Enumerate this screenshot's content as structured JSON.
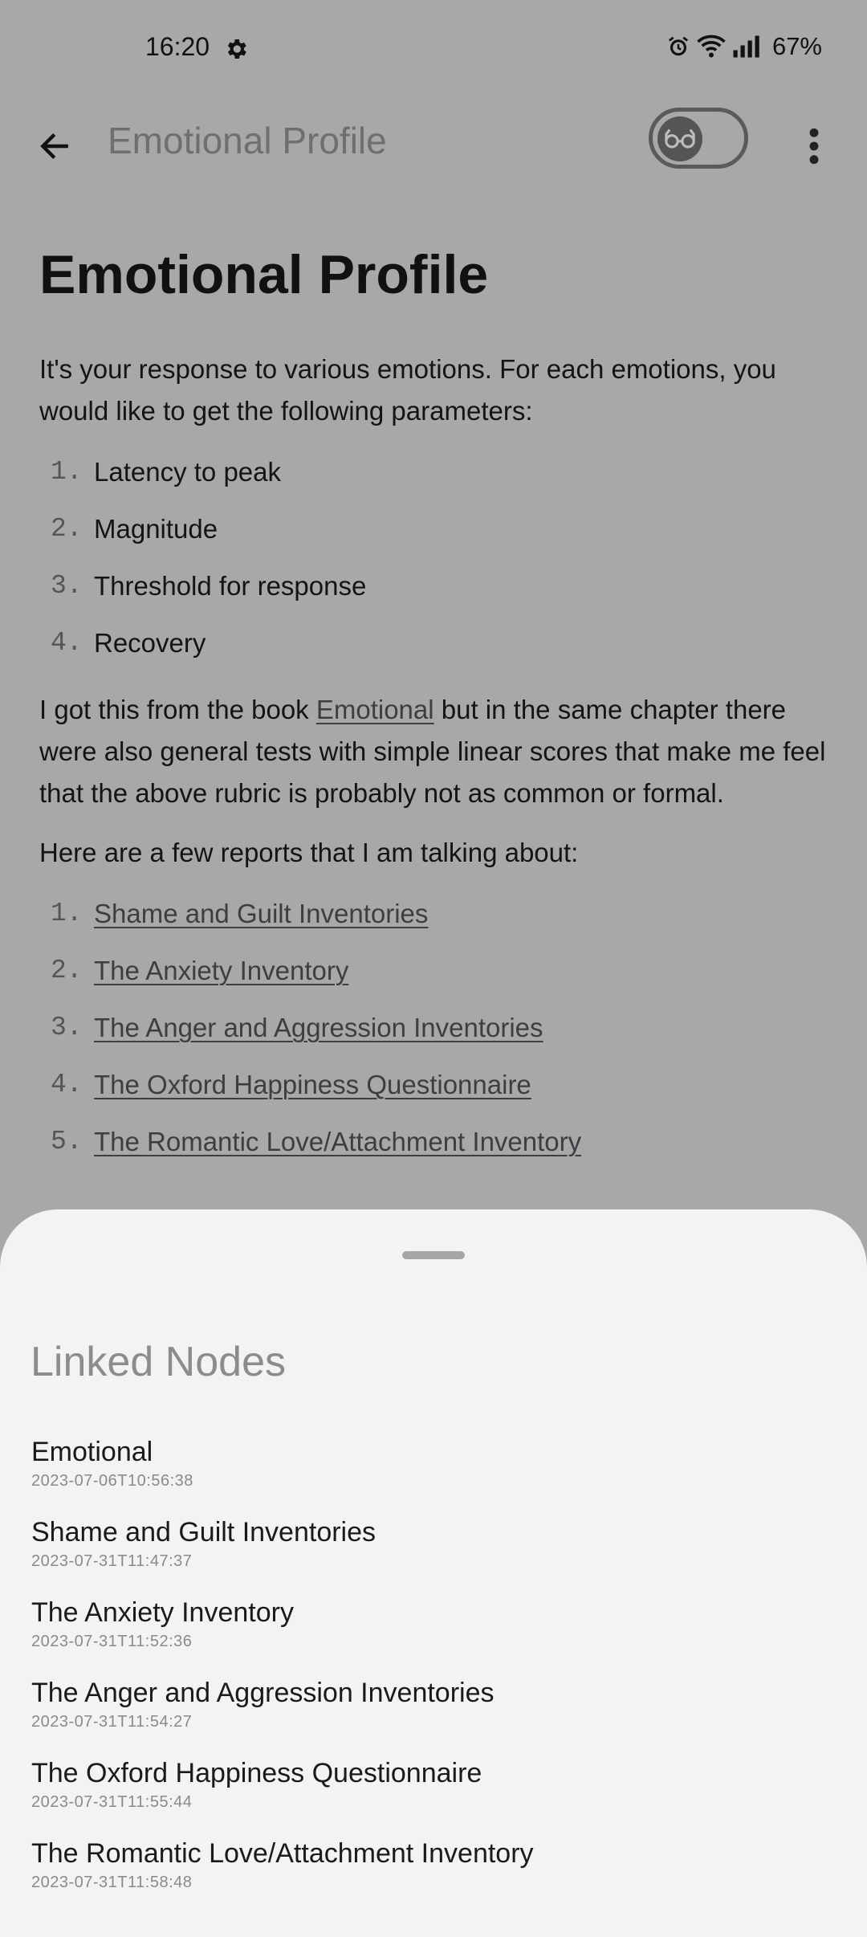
{
  "status": {
    "time": "16:20",
    "battery": "67%"
  },
  "appbar": {
    "title": "Emotional Profile"
  },
  "article": {
    "heading": "Emotional Profile",
    "intro": "It's your response to various emotions. For each emotions, you would like to get the following parameters:",
    "params": [
      {
        "num": "1.",
        "text": "Latency to peak"
      },
      {
        "num": "2.",
        "text": "Magnitude"
      },
      {
        "num": "3.",
        "text": "Threshold for response"
      },
      {
        "num": "4.",
        "text": "Recovery"
      }
    ],
    "para2_before": "I got this from the book ",
    "para2_link": "Emotional",
    "para2_after": " but in the same chapter there were also general tests with simple linear scores that make me feel that the above rubric is probably not as common or formal.",
    "para3": "Here are a few reports that I am talking about:",
    "reports": [
      {
        "num": "1.",
        "text": "Shame and Guilt Inventories"
      },
      {
        "num": "2.",
        "text": "The Anxiety Inventory"
      },
      {
        "num": "3.",
        "text": "The Anger and Aggression Inventories"
      },
      {
        "num": "4.",
        "text": "The Oxford Happiness Questionnaire"
      },
      {
        "num": "5.",
        "text": "The Romantic Love/Attachment Inventory"
      }
    ]
  },
  "sheet": {
    "title": "Linked Nodes",
    "nodes": [
      {
        "name": "Emotional",
        "date": "2023-07-06T10:56:38"
      },
      {
        "name": "Shame and Guilt Inventories",
        "date": "2023-07-31T11:47:37"
      },
      {
        "name": "The Anxiety Inventory",
        "date": "2023-07-31T11:52:36"
      },
      {
        "name": "The Anger and Aggression Inventories",
        "date": "2023-07-31T11:54:27"
      },
      {
        "name": "The Oxford Happiness Questionnaire",
        "date": "2023-07-31T11:55:44"
      },
      {
        "name": "The Romantic Love/Attachment Inventory",
        "date": "2023-07-31T11:58:48"
      }
    ]
  },
  "icons": [
    "settings-gear-icon",
    "alarm-icon",
    "wifi-icon",
    "signal-icon",
    "back-arrow-icon",
    "glasses-icon",
    "more-vert-icon"
  ]
}
